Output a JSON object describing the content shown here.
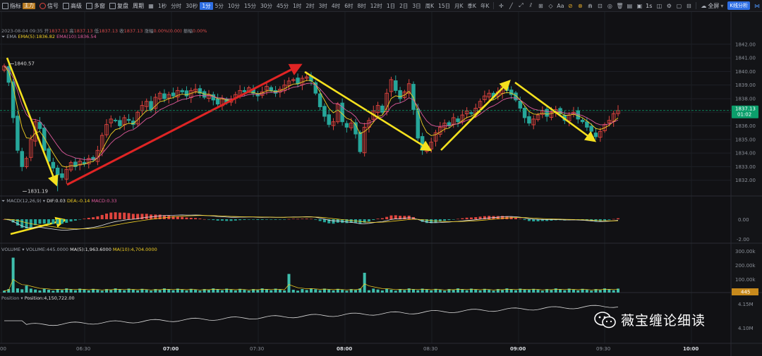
{
  "toolbar": {
    "indicator_label": "指标",
    "indicator_badge": "主力",
    "signal_label": "信号",
    "advanced_label": "高级",
    "multi_label": "多窗",
    "replay_label": "复盘",
    "period_label": "周期",
    "timeframes": [
      "1秒",
      "分时",
      "30秒",
      "1分",
      "5分",
      "10分",
      "15分",
      "30分",
      "45分",
      "1时",
      "2时",
      "3时",
      "4时",
      "6时",
      "8时",
      "12时",
      "1日",
      "2日",
      "3日",
      "周K",
      "15日",
      "月K",
      "季K",
      "年K"
    ],
    "active_timeframe": "1分",
    "tools": [
      "Aa"
    ],
    "right_second": "1s",
    "fullscreen_label": "全屏",
    "kline_analysis_label": "K线分析"
  },
  "info": {
    "datetime": "2023-08-04 09:35",
    "open_label": "开",
    "open": "1837.13",
    "high_label": "高",
    "high": "1837.13",
    "low_label": "低",
    "low": "1837.13",
    "close_label": "收",
    "close": "1837.13",
    "change_label": "涨幅",
    "change": "0.00%(0.00)",
    "amp_label": "振幅",
    "amp": "0.00%"
  },
  "ema": {
    "name": "EMA",
    "ema5": "EMA(5):1836.82",
    "ema10": "EMA(10):1836.54"
  },
  "macd": {
    "name": "MACD(12,26,9)",
    "dif": "DIF:0.03",
    "dea": "DEA:-0.14",
    "macd": "MACD:0.33"
  },
  "volume": {
    "name": "VOLUME",
    "value": "VOLUME:445.0000",
    "ma5": "MA(5):1,963.6000",
    "ma10": "MA(10):4,704.0000"
  },
  "position": {
    "name": "Position",
    "value": "Position:4,150,722.00"
  },
  "price_axis": [
    "1842.00",
    "1841.00",
    "1840.00",
    "1839.00",
    "1838.00",
    "1837.00",
    "1836.00",
    "1835.00",
    "1834.00",
    "1833.00",
    "1832.00"
  ],
  "current_price": "1837.13",
  "countdown": "01:02",
  "high_marker": "1840.57",
  "low_marker": "1831.19",
  "macd_axis": [
    "0.00",
    "-2.00"
  ],
  "volume_axis": [
    "300.00k",
    "200.00k",
    "100.00k"
  ],
  "volume_current": "445",
  "position_axis": [
    "4.15M",
    "4.10M"
  ],
  "time_axis": [
    "00",
    "06:30",
    "07:00",
    "07:30",
    "08:00",
    "08:30",
    "09:00",
    "09:30",
    "10:00"
  ],
  "watermark_text": "薇宝缠论细读",
  "colors": {
    "up": "#e0443e",
    "down": "#26a69a",
    "arrow_yellow": "#f5e11e",
    "arrow_red": "#e02424",
    "accent": "#2f6fe4",
    "current_badge": "#0b9e6b",
    "volume_badge": "#c88a1c"
  },
  "chart_data": {
    "type": "candlestick",
    "ylim": [
      1831,
      1842.3
    ],
    "closes": [
      1840.4,
      1839.2,
      1836.6,
      1834.2,
      1833.0,
      1833.6,
      1835.0,
      1836.3,
      1835.8,
      1834.2,
      1833.4,
      1832.9,
      1832.4,
      1832.2,
      1832.8,
      1833.3,
      1833.0,
      1833.4,
      1833.2,
      1833.6,
      1833.5,
      1834.2,
      1835.3,
      1836.1,
      1836.5,
      1836.4,
      1836.0,
      1836.6,
      1836.4,
      1836.1,
      1837.0,
      1837.5,
      1837.8,
      1837.2,
      1838.1,
      1838.4,
      1838.0,
      1838.3,
      1838.2,
      1838.6,
      1838.5,
      1838.2,
      1838.6,
      1838.7,
      1838.4,
      1838.1,
      1838.3,
      1837.9,
      1837.6,
      1838.0,
      1837.7,
      1837.9,
      1838.3,
      1838.6,
      1838.5,
      1838.8,
      1838.4,
      1838.2,
      1838.5,
      1838.9,
      1838.6,
      1838.4,
      1838.7,
      1839.0,
      1839.3,
      1839.4,
      1839.1,
      1839.5,
      1839.6,
      1839.3,
      1838.4,
      1837.4,
      1836.7,
      1836.1,
      1836.3,
      1837.6,
      1836.3,
      1835.9,
      1836.2,
      1835.4,
      1834.1,
      1835.9,
      1836.4,
      1837.1,
      1837.5,
      1837.0,
      1838.4,
      1839.4,
      1838.6,
      1838.0,
      1838.5,
      1839.1,
      1837.2,
      1835.1,
      1834.2,
      1834.3,
      1834.8,
      1835.5,
      1835.9,
      1836.2,
      1836.0,
      1836.6,
      1836.3,
      1836.8,
      1837.1,
      1836.9,
      1837.3,
      1837.8,
      1838.2,
      1838.4,
      1838.1,
      1838.5,
      1838.9,
      1838.6,
      1838.3,
      1837.9,
      1837.3,
      1836.6,
      1836.2,
      1836.5,
      1836.8,
      1837.1,
      1836.7,
      1837.0,
      1837.2,
      1836.9,
      1836.4,
      1836.8,
      1837.0,
      1836.5,
      1836.3,
      1835.9,
      1835.6,
      1835.2,
      1835.6,
      1836.1,
      1836.4,
      1836.9,
      1837.13
    ]
  }
}
